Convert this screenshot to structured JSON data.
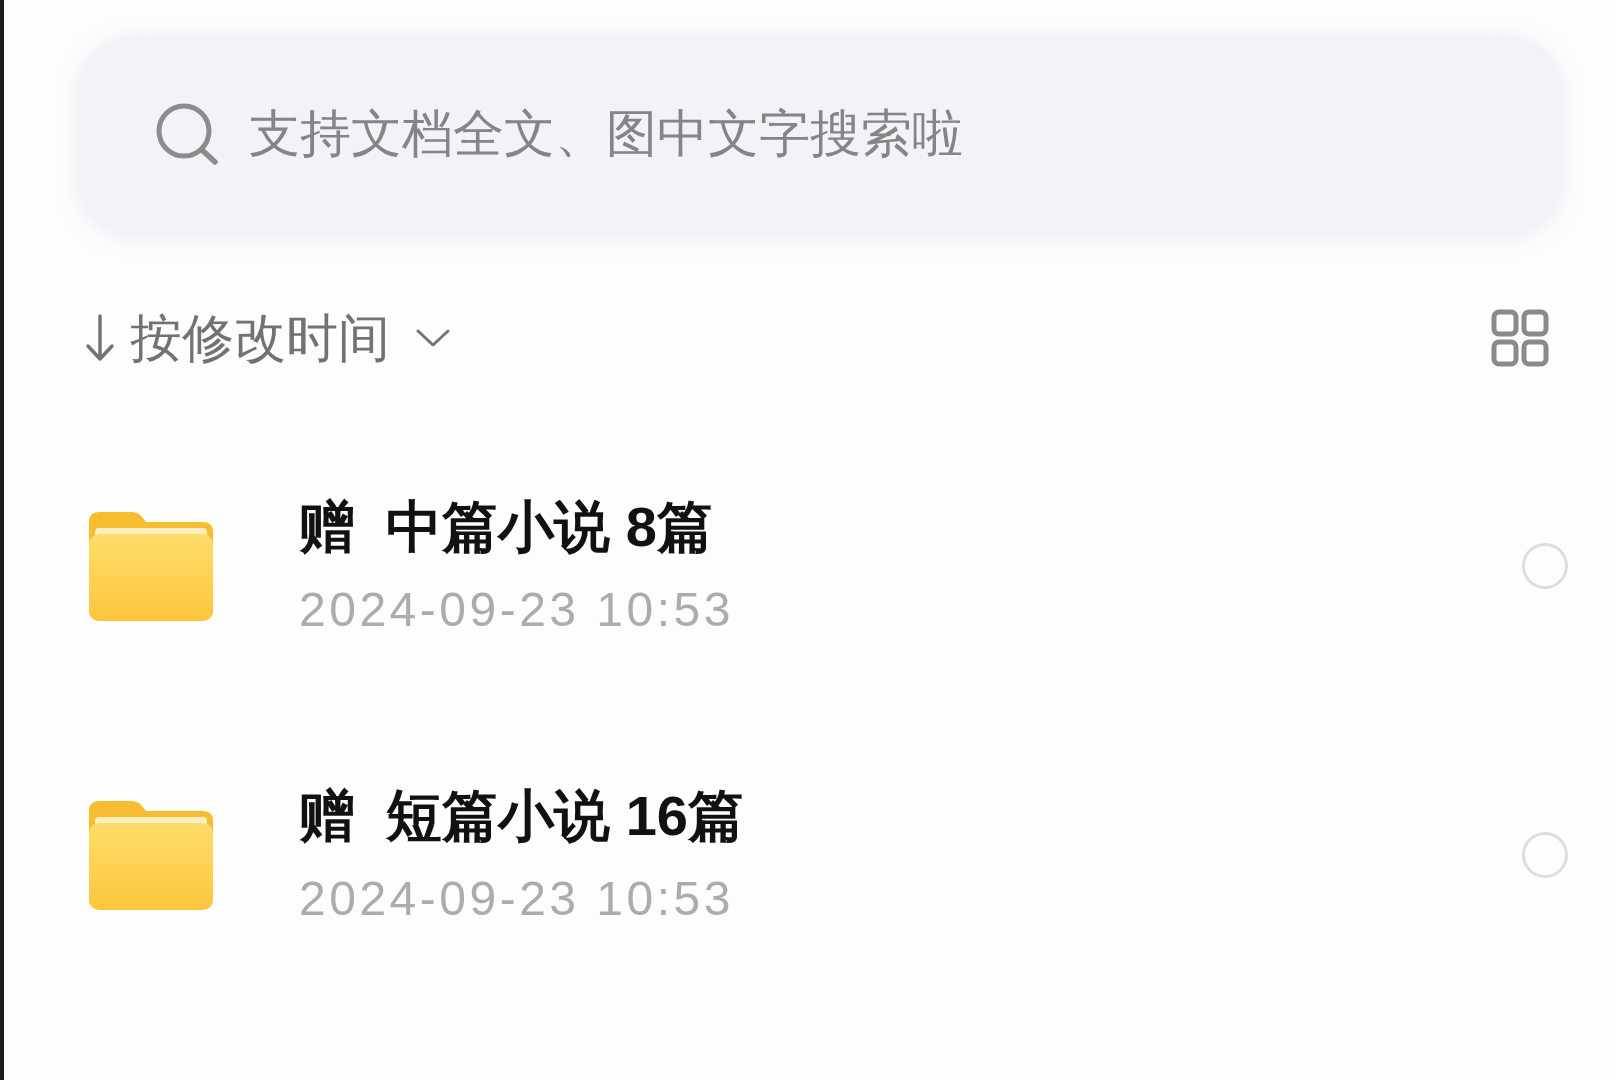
{
  "search": {
    "placeholder": "支持文档全文、图中文字搜索啦"
  },
  "sort": {
    "label": "按修改时间"
  },
  "files": [
    {
      "name": "赠  中篇小说 8篇",
      "modified": "2024-09-23 10:53",
      "selected": false
    },
    {
      "name": "赠  短篇小说 16篇",
      "modified": "2024-09-23 10:53",
      "selected": false
    }
  ]
}
